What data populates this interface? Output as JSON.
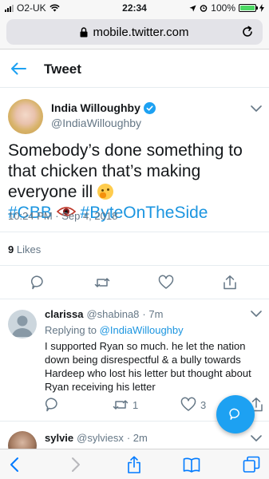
{
  "status_bar": {
    "carrier": "O2-UK",
    "time": "22:34",
    "battery": "100%",
    "battery_level": 1.0
  },
  "browser": {
    "url": "mobile.twitter.com"
  },
  "header": {
    "title": "Tweet"
  },
  "tweet": {
    "author_name": "India Willoughby",
    "handle": "@IndiaWilloughby",
    "text": "Somebody’s done something to that chicken that’s making everyone ill",
    "hashtag_1": "#CBB",
    "hashtag_2": "#ByteOnTheSide",
    "timestamp": "10:24 PM · Sep 4, 2018",
    "likes_count": "9",
    "likes_label": "Likes"
  },
  "reply": {
    "name": "clarissa",
    "handle": "@shabina8",
    "age": "· 7m",
    "replying_prefix": "Replying to",
    "replying_to": "@IndiaWilloughby",
    "text": "I supported Ryan so much. he let the nation down being disrespectful & a bully towards Hardeep who lost his letter but thought about Ryan receiving his letter",
    "retweet_count": "1",
    "like_count": "3"
  },
  "reply2": {
    "name": "sylvie",
    "handle": "@sylviesx",
    "age": "· 2m"
  },
  "colors": {
    "accent": "#1da1f2",
    "link": "#1b95e0",
    "secondary_text": "#657786",
    "primary_text": "#14171a"
  },
  "icons": [
    "signal-bars-icon",
    "wifi-icon",
    "location-arrow-icon",
    "alarm-icon",
    "battery-icon",
    "charging-icon",
    "lock-icon",
    "reload-icon",
    "back-arrow-icon",
    "verified-badge-icon",
    "chevron-down-icon",
    "thinking-face-emoji",
    "eye-emoji",
    "reply-icon",
    "retweet-icon",
    "heart-icon",
    "share-icon",
    "compose-icon",
    "safari-back-icon",
    "safari-forward-icon",
    "safari-share-icon",
    "bookmarks-icon",
    "tabs-icon"
  ]
}
